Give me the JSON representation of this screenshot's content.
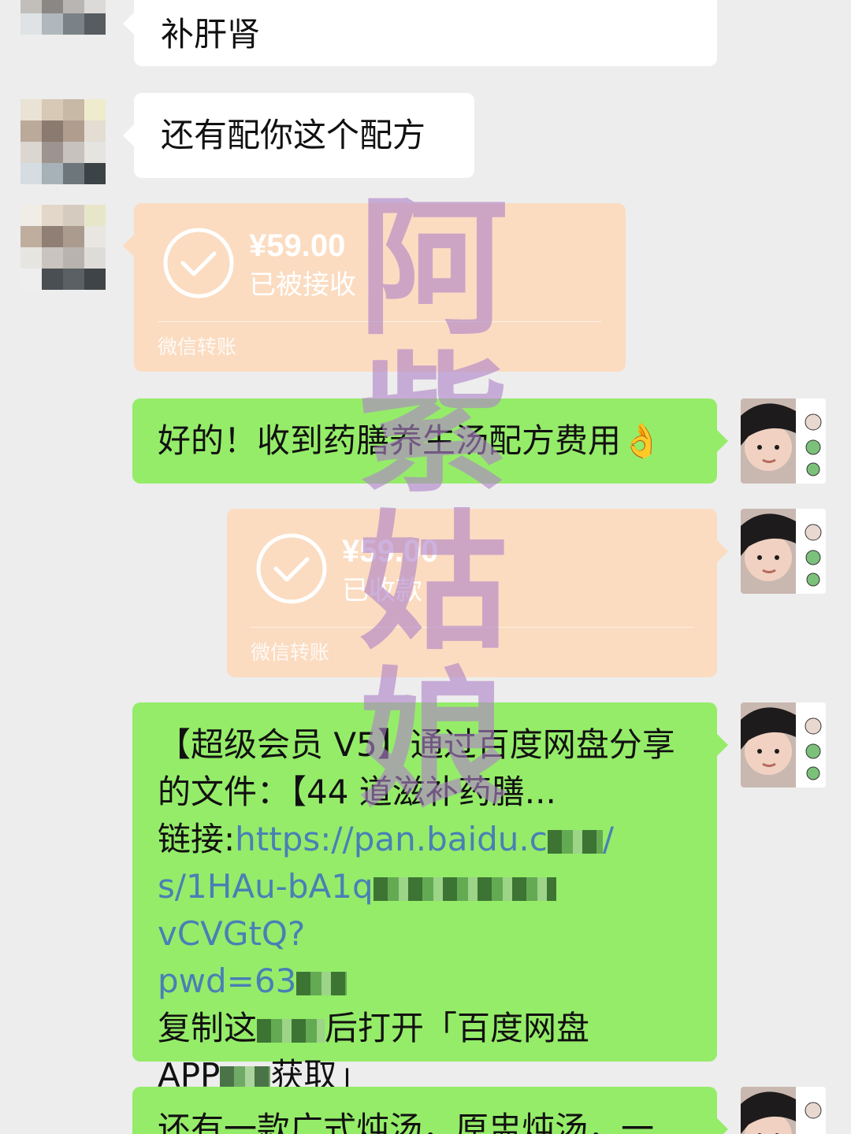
{
  "messages": [
    {
      "side": "left",
      "text": "补肝肾"
    },
    {
      "side": "left",
      "text": "还有配你这个配方"
    },
    {
      "side": "left",
      "type": "transfer",
      "amount": "¥59.00",
      "status": "已被接收",
      "footer": "微信转账"
    },
    {
      "side": "right",
      "text": "好的！收到药膳养生汤配方费用👌"
    },
    {
      "side": "right",
      "type": "transfer",
      "amount": "¥59.00",
      "status": "已收款",
      "footer": "微信转账"
    },
    {
      "side": "right",
      "share": {
        "line1": "【超级会员 V5】通过百度网盘分享",
        "line2": "的文件：【44 道滋补药膳...",
        "link_label": "链接:",
        "link_part1": "https://pan.baidu.c",
        "link_part2": "/",
        "link_part3": "s/1HAu-bA1q",
        "link_part4": "vCVGtQ?",
        "link_part5": "pwd=63",
        "copy_part1": "复制这",
        "copy_part2": "后打开「百度网盘",
        "copy_part3": "APP",
        "copy_part4": "获取」"
      }
    },
    {
      "side": "right",
      "text": "还有一款广式炖汤，原盅炖汤，一"
    }
  ],
  "watermark": [
    "阿",
    "紫",
    "姑",
    "娘"
  ],
  "colors": {
    "background": "#ededed",
    "bubble_self": "#95ec69",
    "bubble_other": "#ffffff",
    "transfer": "#fbdcc1",
    "link": "#4a7fb5",
    "watermark": "#af82c8"
  },
  "icons": [
    "check-circle-icon"
  ]
}
